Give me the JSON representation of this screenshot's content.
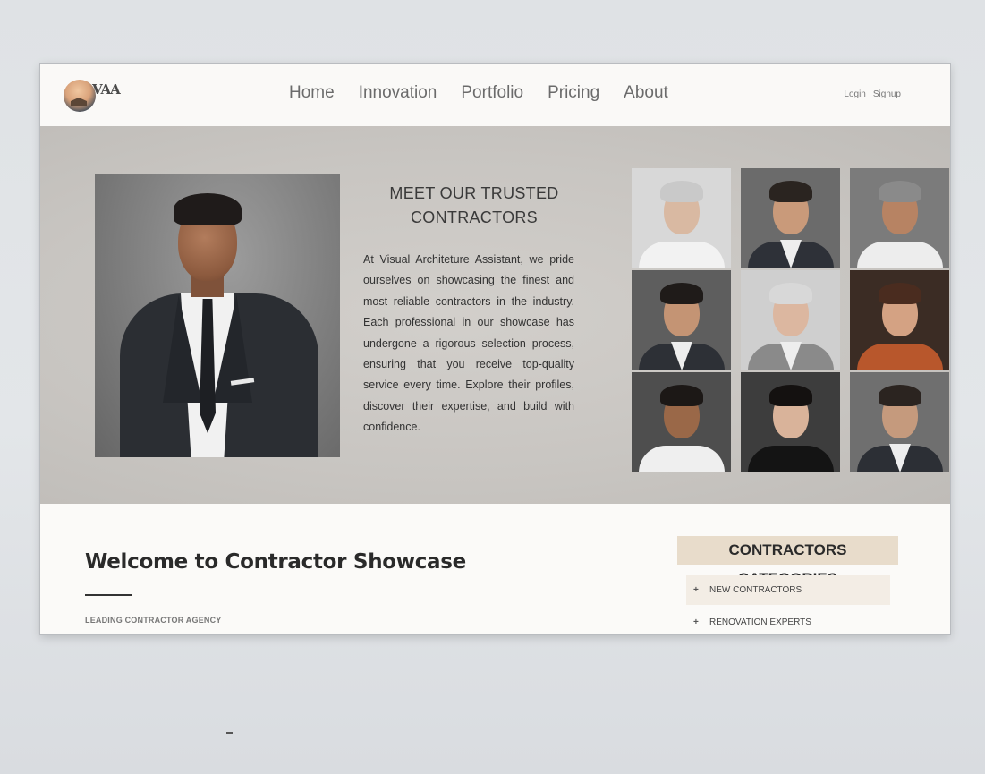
{
  "header": {
    "logo_text": "VAA",
    "nav": [
      "Home",
      "Innovation",
      "Portfolio",
      "Pricing",
      "About"
    ],
    "login": "Login",
    "signup": "Signup"
  },
  "hero": {
    "title_line1": "MEET OUR TRUSTED",
    "title_line2": "CONTRACTORS",
    "body": "At Visual Architeture Assistant, we pride ourselves on showcasing the finest and most reliable contractors in the industry. Each professional in our showcase has undergone a rigorous selection process, ensuring that you receive top-quality service every time. Explore their profiles, discover their expertise, and build with confidence."
  },
  "section": {
    "title": "Welcome to Contractor Showcase",
    "subtitle": "LEADING CONTRACTOR AGENCY",
    "categories_title": "CONTRACTORS CATEGORIES",
    "categories": [
      "NEW CONTRACTORS",
      "RENOVATION EXPERTS"
    ]
  },
  "colors": {
    "page_bg": "#fbfaf8",
    "hero_bg": "#c8c5c1",
    "category_header_bg": "#e8dccb",
    "category_item_bg": "#f3ede5",
    "text_dark": "#2a2a2a"
  },
  "contractor_portraits": 9
}
